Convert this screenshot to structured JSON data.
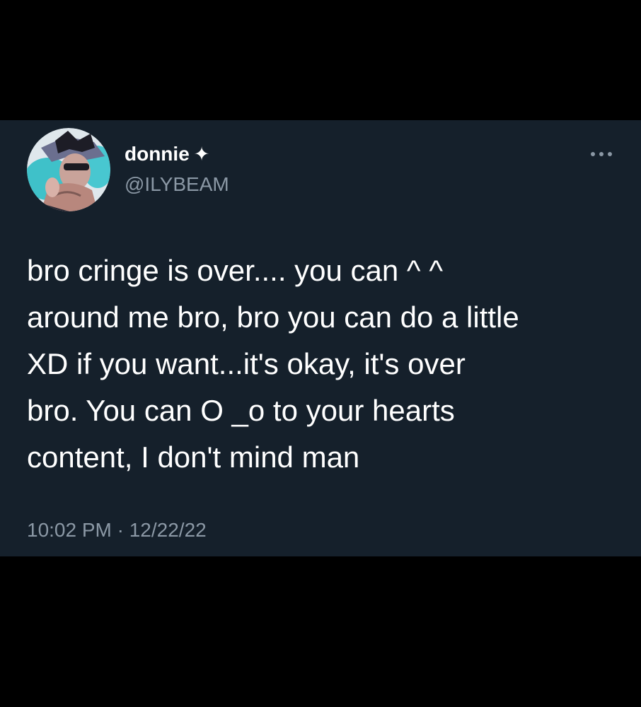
{
  "tweet": {
    "author": {
      "display_name": "donnie",
      "name_symbol": "✦",
      "handle": "@ILYBEAM",
      "avatar_icon": "anime-character-avatar"
    },
    "more_icon": "more-horizontal-icon",
    "text": "bro cringe is over.... you can ^ ^\naround me bro, bro you can do a little\nXD if you want...it's okay, it's over\nbro. You can O _o to your hearts\ncontent, I don't mind man",
    "timestamp": "10:02 PM · 12/22/22"
  },
  "colors": {
    "background": "#000000",
    "card": "#15202b",
    "primary_text": "#ffffff",
    "secondary_text": "#8b98a5"
  }
}
